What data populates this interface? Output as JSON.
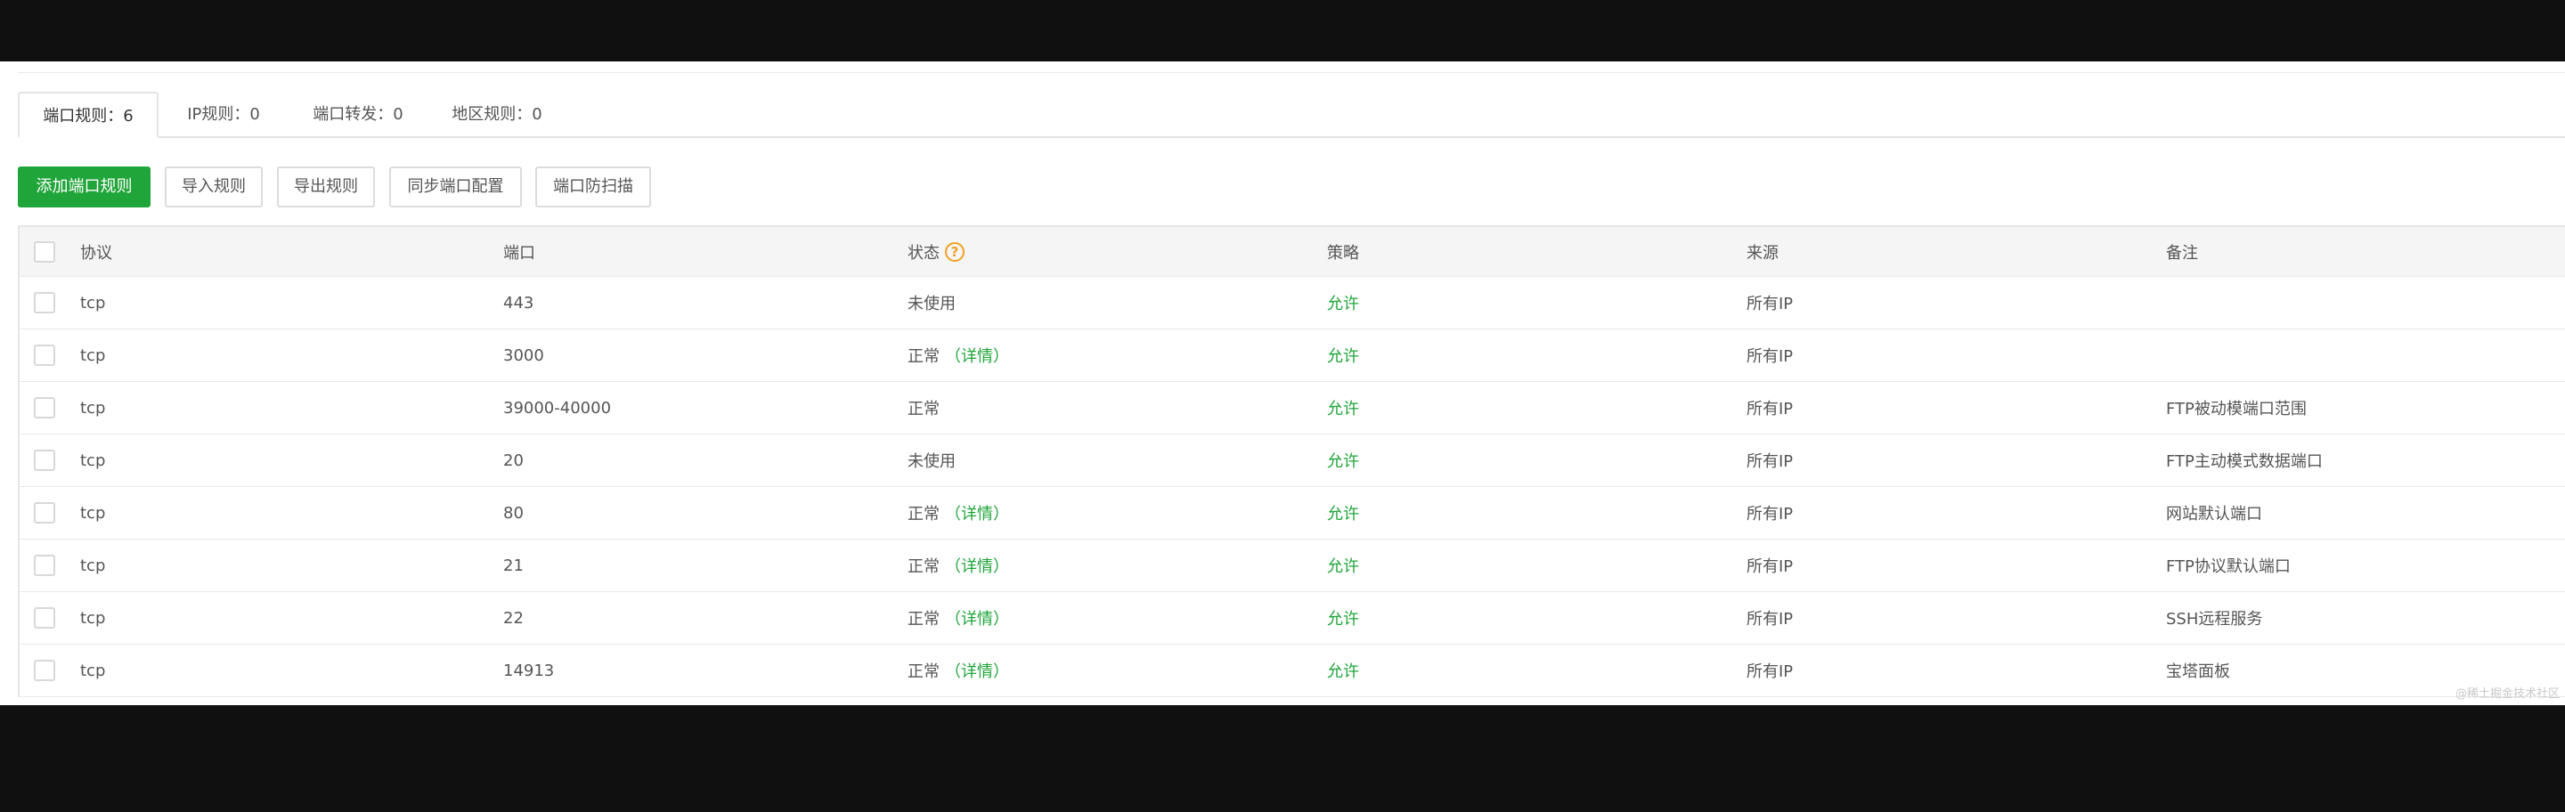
{
  "tabs": [
    {
      "label": "端口规则：6",
      "active": true
    },
    {
      "label": "IP规则：0",
      "active": false
    },
    {
      "label": "端口转发：0",
      "active": false
    },
    {
      "label": "地区规则：0",
      "active": false
    }
  ],
  "toolbar": {
    "add_label": "添加端口规则",
    "import_label": "导入规则",
    "export_label": "导出规则",
    "sync_label": "同步端口配置",
    "scan_label": "端口防扫描"
  },
  "table": {
    "headers": {
      "protocol": "协议",
      "port": "端口",
      "status": "状态",
      "status_help": "?",
      "policy": "策略",
      "source": "来源",
      "note": "备注"
    },
    "rows": [
      {
        "protocol": "tcp",
        "port": "443",
        "status": "未使用",
        "detail": "",
        "policy": "允许",
        "source": "所有IP",
        "note": ""
      },
      {
        "protocol": "tcp",
        "port": "3000",
        "status": "正常",
        "detail": "（详情）",
        "policy": "允许",
        "source": "所有IP",
        "note": ""
      },
      {
        "protocol": "tcp",
        "port": "39000-40000",
        "status": "正常",
        "detail": "",
        "policy": "允许",
        "source": "所有IP",
        "note": "FTP被动模端口范围"
      },
      {
        "protocol": "tcp",
        "port": "20",
        "status": "未使用",
        "detail": "",
        "policy": "允许",
        "source": "所有IP",
        "note": "FTP主动模式数据端口"
      },
      {
        "protocol": "tcp",
        "port": "80",
        "status": "正常",
        "detail": "（详情）",
        "policy": "允许",
        "source": "所有IP",
        "note": "网站默认端口"
      },
      {
        "protocol": "tcp",
        "port": "21",
        "status": "正常",
        "detail": "（详情）",
        "policy": "允许",
        "source": "所有IP",
        "note": "FTP协议默认端口"
      },
      {
        "protocol": "tcp",
        "port": "22",
        "status": "正常",
        "detail": "（详情）",
        "policy": "允许",
        "source": "所有IP",
        "note": "SSH远程服务"
      },
      {
        "protocol": "tcp",
        "port": "14913",
        "status": "正常",
        "detail": "（详情）",
        "policy": "允许",
        "source": "所有IP",
        "note": "宝塔面板"
      }
    ]
  },
  "watermark": "@稀土掘金技术社区",
  "colors": {
    "accent": "#20a53a",
    "help": "#f0a020",
    "background": "#101010"
  }
}
